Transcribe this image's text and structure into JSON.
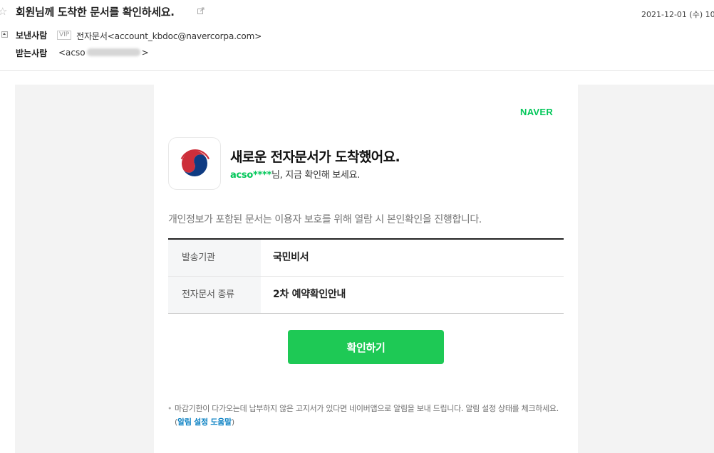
{
  "mail": {
    "subject": "회원님께 도착한 문서를 확인하세요.",
    "date": "2021-12-01 (수) 10",
    "from_label": "보낸사람",
    "vip_badge": "VIP",
    "from_value": "전자문서<account_kbdoc@navercorpa.com>",
    "to_label": "받는사람",
    "to_prefix": "<acso",
    "to_suffix": ">"
  },
  "content": {
    "brand": "NAVER",
    "headline": "새로운 전자문서가 도착했어요.",
    "greeting_uid": "acso****",
    "greeting_rest": "님, 지금 확인해 보세요.",
    "notice": "개인정보가 포함된 문서는 이용자 보호를 위해 열람 시 본인확인을 진행합니다.",
    "table": [
      {
        "key": "발송기관",
        "value": "국민비서"
      },
      {
        "key": "전자문서 종류",
        "value": "2차 예약확인안내"
      }
    ],
    "confirm_button": "확인하기",
    "footnote_bullet": "•",
    "footnote_text": "마감기한이 다가오는데 납부하지 않은 고지서가 있다면 네이버앱으로 알림을 보내 드립니다. 알림 설정 상태를 체크하세요. (",
    "footnote_link": "알림 설정 도움말",
    "footnote_close": ")"
  },
  "colors": {
    "naver_green": "#03c75a",
    "button_green": "#1ec955",
    "link_blue": "#0e83c4",
    "taegeuk_red": "#cd2e3a",
    "taegeuk_blue": "#0f3b82"
  },
  "icons": {
    "star": "star-outline-icon",
    "external": "external-link-icon",
    "toggle": "collapse-toggle-icon",
    "logo": "taegeuk-emblem-icon"
  }
}
